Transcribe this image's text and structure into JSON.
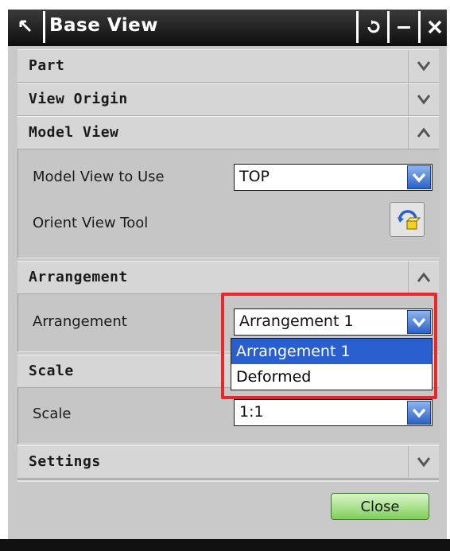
{
  "window": {
    "title": "Base View"
  },
  "sections": {
    "part": {
      "label": "Part"
    },
    "view_origin": {
      "label": "View Origin"
    },
    "model_view": {
      "label": "Model View",
      "model_view_to_use_label": "Model View to Use",
      "model_view_to_use_value": "TOP",
      "orient_view_tool_label": "Orient View Tool"
    },
    "arrangement": {
      "label": "Arrangement",
      "field_label": "Arrangement",
      "field_value": "Arrangement 1",
      "options": [
        "Arrangement 1",
        "Deformed"
      ],
      "selected_index": 0
    },
    "scale": {
      "label": "Scale",
      "field_label": "Scale",
      "field_value": "1:1"
    },
    "settings": {
      "label": "Settings"
    }
  },
  "buttons": {
    "close": "Close"
  },
  "colors": {
    "highlight_box": "#e8262b",
    "selected_option": "#2a5fd0",
    "close_button": "#7fcf5a"
  }
}
